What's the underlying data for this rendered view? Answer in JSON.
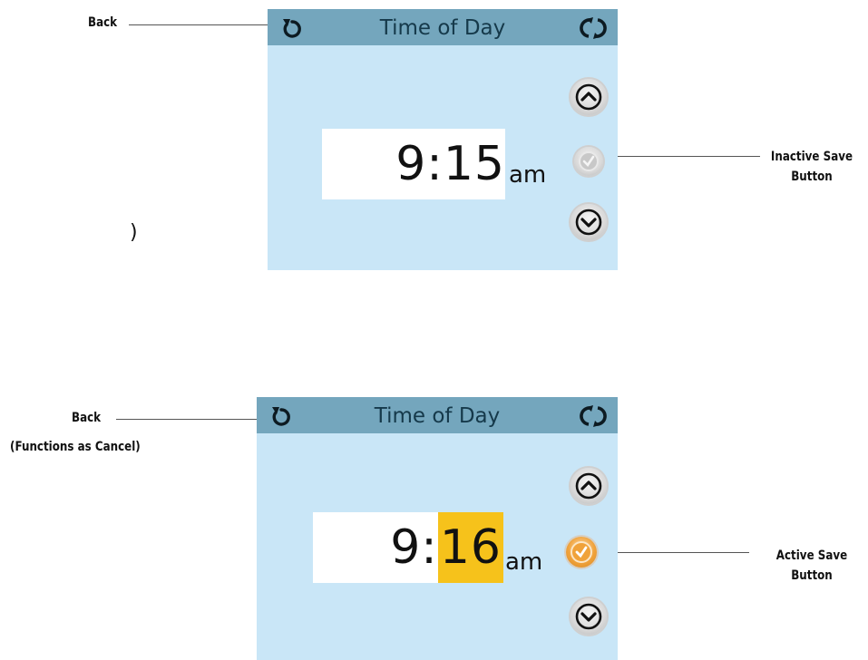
{
  "annotations": {
    "top_back": "Back",
    "top_inactive_save_line1": "Inactive Save",
    "top_inactive_save_line2": "Button",
    "bottom_back": "Back",
    "bottom_back_sub": "(Functions as Cancel)",
    "bottom_active_save_line1": "Active Save",
    "bottom_active_save_line2": "Button",
    "stray_char": ")"
  },
  "screens": [
    {
      "title": "Time of Day",
      "time_prefix": "9:15",
      "time_highlight": "",
      "ampm": "am",
      "save_state": "inactive"
    },
    {
      "title": "Time of Day",
      "time_prefix": "9:",
      "time_highlight": "16",
      "ampm": "am",
      "save_state": "active"
    }
  ],
  "colors": {
    "panel_bg": "#c9e6f7",
    "header_bg": "#74a6bd",
    "highlight": "#f6c21b",
    "save_active": "#f0a23a",
    "save_inactive": "#c8c8c8"
  },
  "icons": {
    "back": "back-arrow-icon",
    "refresh": "refresh-icon",
    "up": "chevron-up-icon",
    "down": "chevron-down-icon",
    "save": "checkmark-icon"
  }
}
